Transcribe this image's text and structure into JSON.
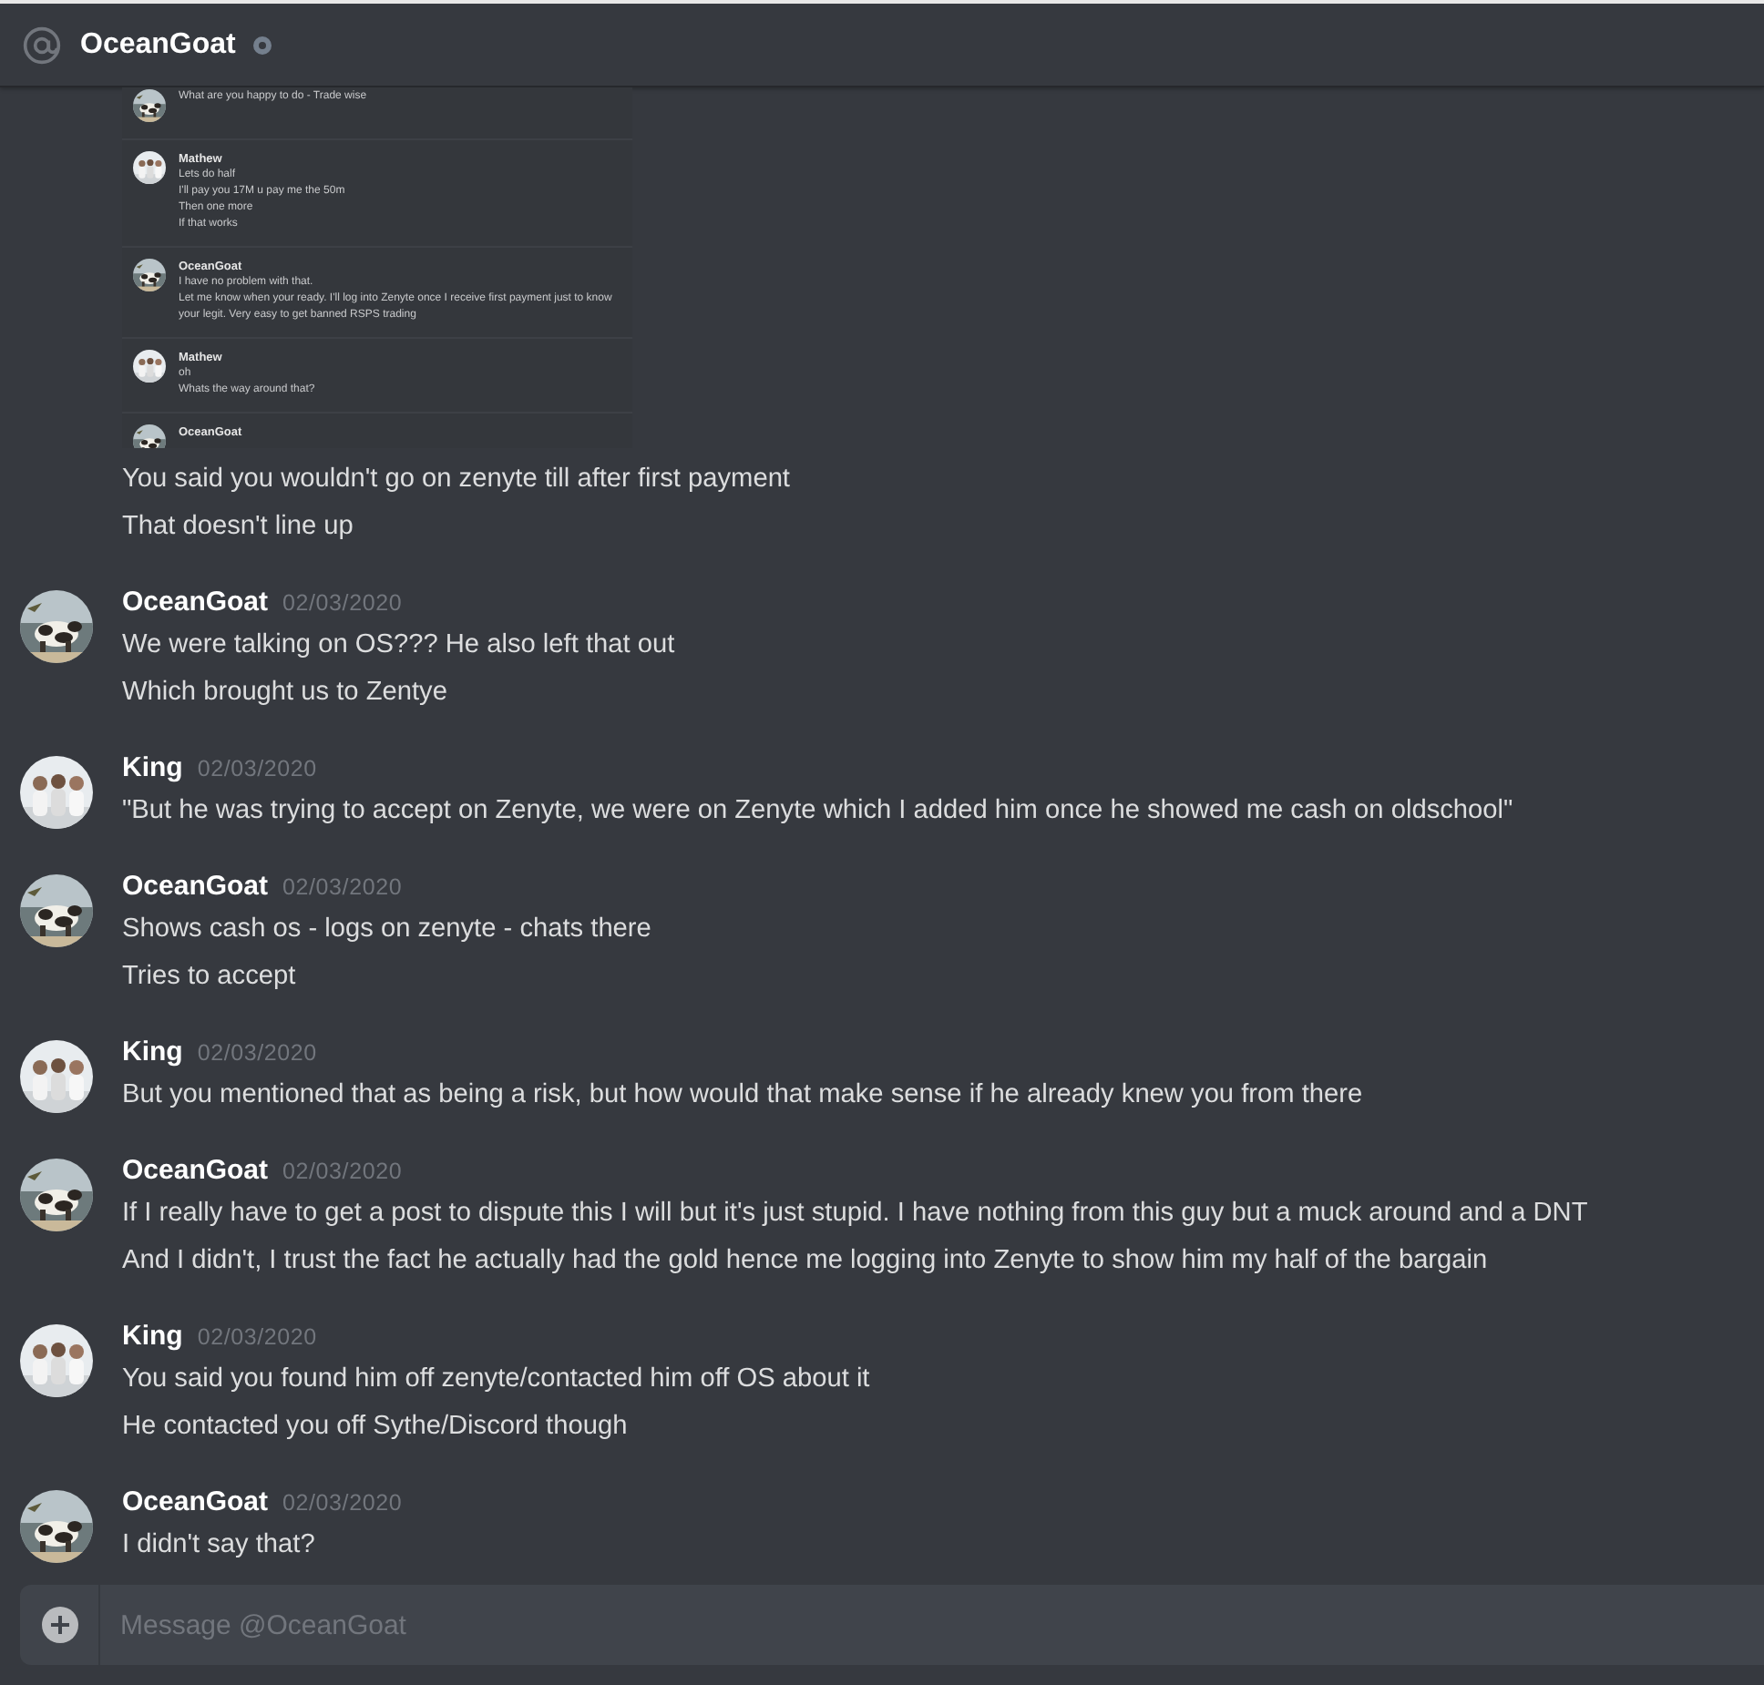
{
  "header": {
    "recipient": "OceanGoat",
    "online": false
  },
  "messages": [
    {
      "kind": "continuation",
      "attachment": {
        "rows": [
          {
            "lines": [
              "What are you happy to do - Trade wise"
            ]
          },
          {
            "author": "Mathew",
            "lines": [
              "Lets do half",
              "I'll pay you 17M u pay me the 50m",
              "Then one more",
              "If that works"
            ]
          },
          {
            "author": "OceanGoat",
            "lines": [
              "I have no problem with that.",
              "Let me know when your ready. I'll log into Zenyte once I receive first payment just to know your legit. Very easy to get banned RSPS trading"
            ]
          },
          {
            "author": "Mathew",
            "lines": [
              "oh",
              "Whats the way around that?"
            ]
          },
          {
            "author": "OceanGoat",
            "lines": []
          }
        ]
      },
      "lines": [
        "You said you wouldn't go on zenyte till after first payment",
        "That doesn't line up"
      ]
    },
    {
      "kind": "group",
      "author": "OceanGoat",
      "timestamp": "02/03/2020",
      "lines": [
        "We were talking on OS??? He also left that out",
        "Which brought us to Zentye"
      ]
    },
    {
      "kind": "group",
      "author": "King",
      "timestamp": "02/03/2020",
      "lines": [
        "\"But he was trying to accept on Zenyte, we were on Zenyte which I added him once he showed me cash on oldschool\""
      ]
    },
    {
      "kind": "group",
      "author": "OceanGoat",
      "timestamp": "02/03/2020",
      "lines": [
        "Shows cash os - logs on zenyte - chats there",
        "Tries to accept"
      ]
    },
    {
      "kind": "group",
      "author": "King",
      "timestamp": "02/03/2020",
      "lines": [
        "But you mentioned that as being a risk, but how would that make sense if he already knew you from there"
      ]
    },
    {
      "kind": "group",
      "author": "OceanGoat",
      "timestamp": "02/03/2020",
      "lines": [
        "If I really have to get a post to dispute this I will but it's just stupid. I have nothing from this guy but a muck around and a DNT",
        "And I didn't, I trust the fact he actually had the gold hence me logging into Zenyte to show him my half of the bargain"
      ]
    },
    {
      "kind": "group",
      "author": "King",
      "timestamp": "02/03/2020",
      "lines": [
        "You said you found him off zenyte/contacted him off OS about it",
        "He contacted you off Sythe/Discord though"
      ]
    },
    {
      "kind": "group",
      "author": "OceanGoat",
      "timestamp": "02/03/2020",
      "lines": [
        "I didn't say that?"
      ]
    }
  ],
  "composer": {
    "placeholder": "Message @OceanGoat"
  }
}
